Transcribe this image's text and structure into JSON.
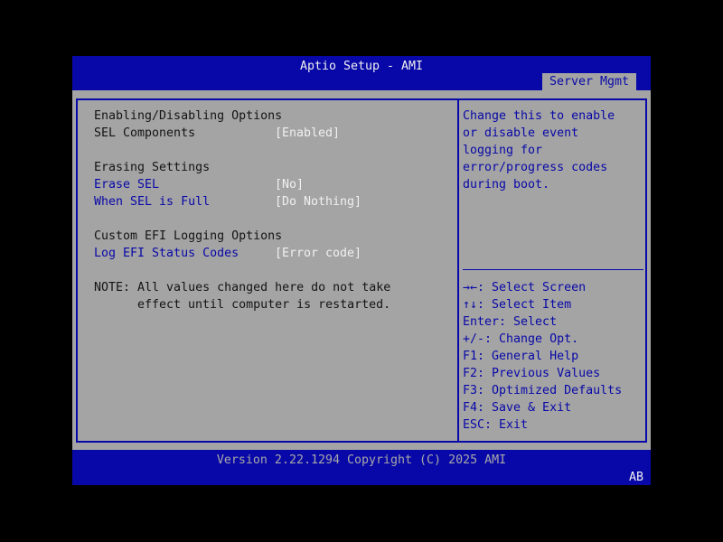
{
  "header": {
    "title": "Aptio Setup - AMI",
    "active_tab": "Server Mgmt"
  },
  "main": {
    "sections": [
      {
        "heading": "Enabling/Disabling Options",
        "items": [
          {
            "label": "SEL Components",
            "value": "[Enabled]"
          }
        ]
      },
      {
        "heading": "Erasing Settings",
        "items": [
          {
            "label": "Erase SEL",
            "value": "[No]"
          },
          {
            "label": "When SEL is Full",
            "value": "[Do Nothing]"
          }
        ]
      },
      {
        "heading": "Custom EFI Logging Options",
        "items": [
          {
            "label": "Log EFI Status Codes",
            "value": "[Error code]"
          }
        ]
      }
    ],
    "note_line1": "NOTE: All values changed here do not take",
    "note_line2": "effect until computer is restarted."
  },
  "help": {
    "lines": [
      "Change this to enable",
      "or disable event",
      "logging for",
      "error/progress codes",
      "during boot."
    ]
  },
  "keys": [
    "→←: Select Screen",
    "↑↓: Select Item",
    "Enter: Select",
    "+/-: Change Opt.",
    "F1: General Help",
    "F2: Previous Values",
    "F3: Optimized Defaults",
    "F4: Save & Exit",
    "ESC: Exit"
  ],
  "footer": {
    "version": "Version 2.22.1294 Copyright (C) 2025 AMI",
    "badge": "AB"
  }
}
